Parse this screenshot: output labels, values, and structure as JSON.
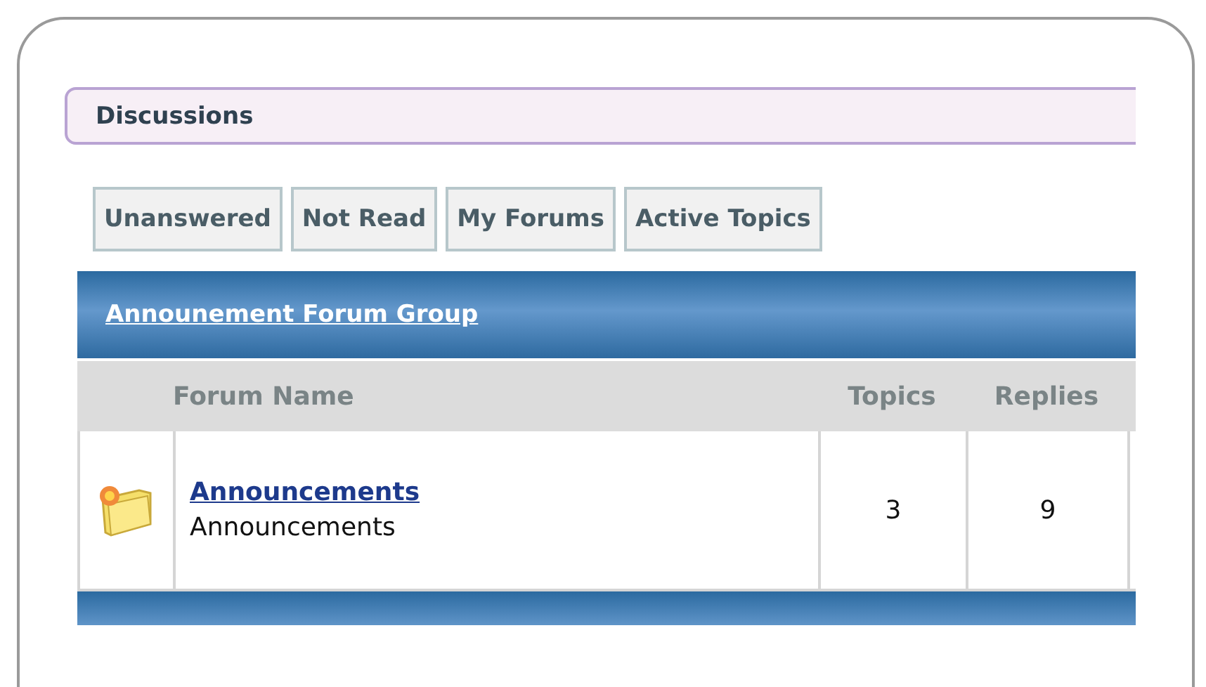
{
  "panel": {
    "title": "Discussions"
  },
  "filters": [
    "Unanswered",
    "Not Read",
    "My Forums",
    "Active Topics"
  ],
  "group": {
    "title": "Announement Forum Group",
    "columns": [
      "Forum Name",
      "Topics",
      "Replies"
    ],
    "rows": [
      {
        "title": "Announcements",
        "description": "Announcements",
        "topics": "3",
        "replies": "9"
      }
    ]
  }
}
